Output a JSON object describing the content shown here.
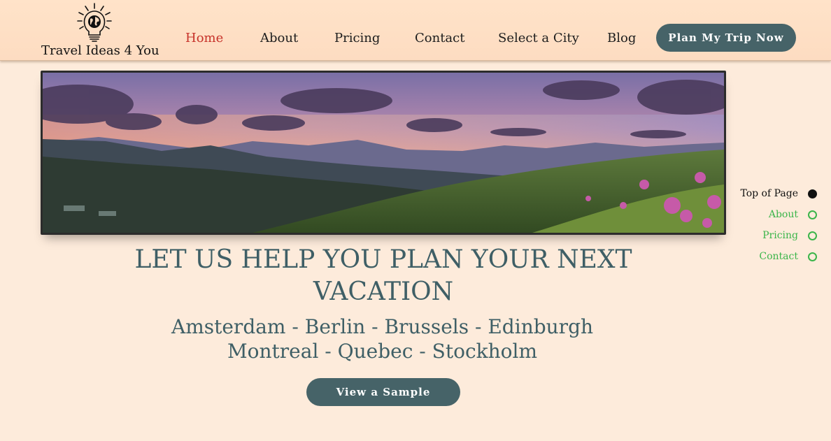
{
  "brand": {
    "name": "Travel Ideas 4 You",
    "logo_icon": "lightbulb-globe-icon"
  },
  "nav": {
    "items": [
      {
        "label": "Home",
        "active": true
      },
      {
        "label": "About",
        "active": false
      },
      {
        "label": "Pricing",
        "active": false
      },
      {
        "label": "Contact",
        "active": false
      },
      {
        "label": "Select a City",
        "active": false
      },
      {
        "label": "Blog",
        "active": false
      }
    ],
    "cta_label": "Plan My Trip Now"
  },
  "banner": {
    "image": "mountain-sunset-landscape-image"
  },
  "hero": {
    "headline": "LET US HELP YOU PLAN YOUR NEXT VACATION",
    "cities_line1": "Amsterdam - Berlin - Brussels - Edinburgh",
    "cities_line2": "Montreal - Quebec - Stockholm",
    "sample_button": "View a Sample"
  },
  "anchor_menu": {
    "items": [
      {
        "label": "Top of Page",
        "active": true
      },
      {
        "label": "About",
        "active": false
      },
      {
        "label": "Pricing",
        "active": false
      },
      {
        "label": "Contact",
        "active": false
      }
    ]
  },
  "colors": {
    "background": "#fdebdb",
    "header": "#fddcc1",
    "accent_button": "#466368",
    "active_nav": "#c7322a",
    "heading_text": "#3f5f66",
    "anchor_green": "#3bb54a"
  }
}
